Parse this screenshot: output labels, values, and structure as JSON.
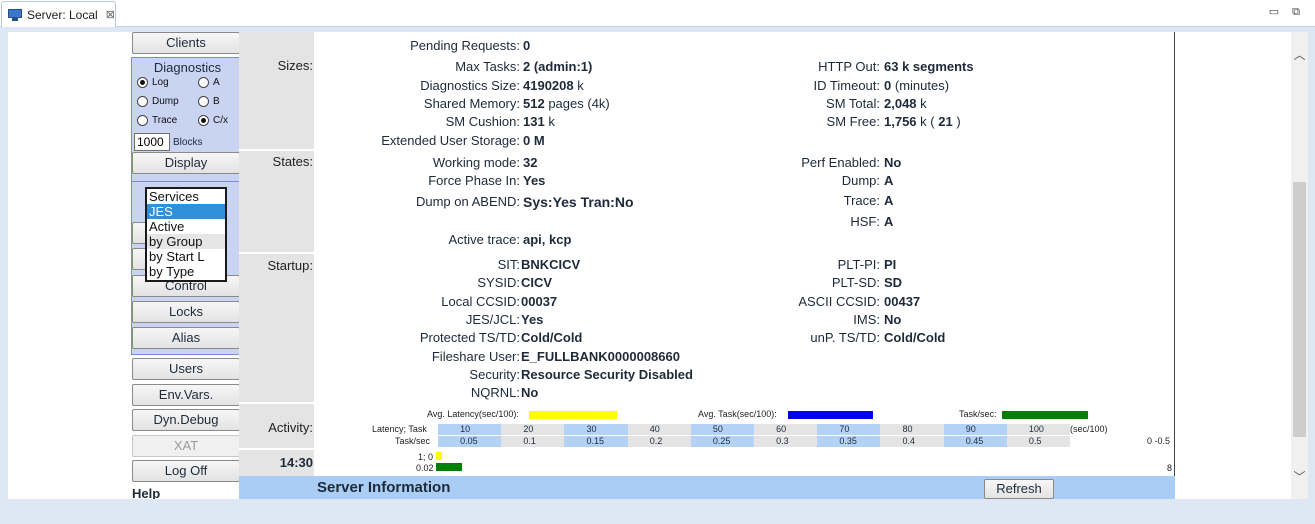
{
  "window": {
    "tab_title": "Server: Local",
    "close_glyph": "⊠",
    "minimize_glyph": "▭",
    "restore_glyph": "⧉"
  },
  "nav": {
    "clients": "Clients",
    "diagnostics": {
      "title": "Diagnostics",
      "radios": [
        {
          "label": "Log",
          "checked": true
        },
        {
          "label": "A",
          "checked": false
        },
        {
          "label": "Dump",
          "checked": false
        },
        {
          "label": "B",
          "checked": false
        },
        {
          "label": "Trace",
          "checked": false
        },
        {
          "label": "C/x",
          "checked": true
        }
      ],
      "blocks_value": "1000",
      "blocks_label": "Blocks",
      "display": "Display"
    },
    "services_list": {
      "options": [
        "Services",
        "JES",
        "Active",
        "by Group",
        "by Start L",
        "by Type"
      ],
      "selected": "JES"
    },
    "control": "Control",
    "locks": "Locks",
    "alias": "Alias",
    "users": "Users",
    "envvars": "Env.Vars.",
    "dyndebug": "Dyn.Debug",
    "xat": "XAT",
    "logoff": "Log Off",
    "help": "Help"
  },
  "sections": {
    "sizes": "Sizes:",
    "states": "States:",
    "startup": "Startup:",
    "activity": "Activity:",
    "time": "14:30"
  },
  "fields": {
    "pending_requests": {
      "label": "Pending Requests:",
      "value": "0"
    },
    "max_tasks": {
      "label": "Max Tasks:",
      "value": "2 (admin:1)"
    },
    "diag_size": {
      "label": "Diagnostics Size:",
      "value": "4190208",
      "unit": "k"
    },
    "shared_memory": {
      "label": "Shared Memory:",
      "value": "512",
      "unit": "pages (4k)"
    },
    "sm_cushion": {
      "label": "SM Cushion:",
      "value": "131",
      "unit": "k"
    },
    "ext_user_storage": {
      "label": "Extended User Storage:",
      "value": "0 M"
    },
    "http_out": {
      "label": "HTTP Out:",
      "value": "63 k segments"
    },
    "id_timeout": {
      "label": "ID Timeout:",
      "value": "0",
      "unit": "(minutes)"
    },
    "sm_total": {
      "label": "SM Total:",
      "value": "2,048",
      "unit": "k"
    },
    "sm_free": {
      "label": "SM Free:",
      "value": "1,756",
      "unit": "k (",
      "value2": "21",
      "unit2": ")"
    },
    "working_mode": {
      "label": "Working mode:",
      "value": "32"
    },
    "force_phase_in": {
      "label": "Force Phase In:",
      "value": "Yes"
    },
    "dump_on_abend": {
      "label": "Dump on ABEND:",
      "value": "Sys:Yes Tran:No"
    },
    "active_trace": {
      "label": "Active trace:",
      "value": "api, kcp"
    },
    "perf_enabled": {
      "label": "Perf Enabled:",
      "value": "No"
    },
    "dump": {
      "label": "Dump:",
      "value": "A"
    },
    "trace": {
      "label": "Trace:",
      "value": "A"
    },
    "hsf": {
      "label": "HSF:",
      "value": "A"
    },
    "sit": {
      "label": "SIT:",
      "value": "BNKCICV"
    },
    "sysid": {
      "label": "SYSID:",
      "value": "CICV"
    },
    "local_ccsid": {
      "label": "Local CCSID:",
      "value": "00037"
    },
    "jes_jcl": {
      "label": "JES/JCL:",
      "value": "Yes"
    },
    "protected_ts_td": {
      "label": "Protected TS/TD:",
      "value": "Cold/Cold"
    },
    "fileshare_user": {
      "label": "Fileshare User:",
      "value": "E_FULLBANK0000008660"
    },
    "security": {
      "label": "Security:",
      "value": "Resource Security Disabled"
    },
    "nqrnl": {
      "label": "NQRNL:",
      "value": "No"
    },
    "plt_pi": {
      "label": "PLT-PI:",
      "value": "PI"
    },
    "plt_sd": {
      "label": "PLT-SD:",
      "value": "SD"
    },
    "ascii_ccsid": {
      "label": "ASCII CCSID:",
      "value": "00437"
    },
    "ims": {
      "label": "IMS:",
      "value": "No"
    },
    "unp_ts_td": {
      "label": "unP. TS/TD:",
      "value": "Cold/Cold"
    }
  },
  "activity": {
    "legend": {
      "avg_latency": "Avg. Latency(sec/100):",
      "avg_task": "Avg. Task(sec/100):",
      "task_sec": "Task/sec:"
    },
    "colors": {
      "latency": "#ffff00",
      "task": "#0000ee",
      "tasksec": "#008000"
    },
    "latency_row": {
      "label": "Latency; Task",
      "ticks": [
        "10",
        "20",
        "30",
        "40",
        "50",
        "60",
        "70",
        "80",
        "90",
        "100"
      ],
      "unit": "(sec/100)"
    },
    "tasksec_row": {
      "label": "Task/sec",
      "ticks": [
        "0.05",
        "0.1",
        "0.15",
        "0.2",
        "0.25",
        "0.3",
        "0.35",
        "0.4",
        "0.45",
        "0.5"
      ],
      "range_note": "0 -0.5"
    },
    "current": {
      "latency_label": "1; 0",
      "tasksec_label": "0.02",
      "right_value": "8"
    }
  },
  "footer": {
    "title": "Server Information",
    "refresh": "Refresh"
  }
}
